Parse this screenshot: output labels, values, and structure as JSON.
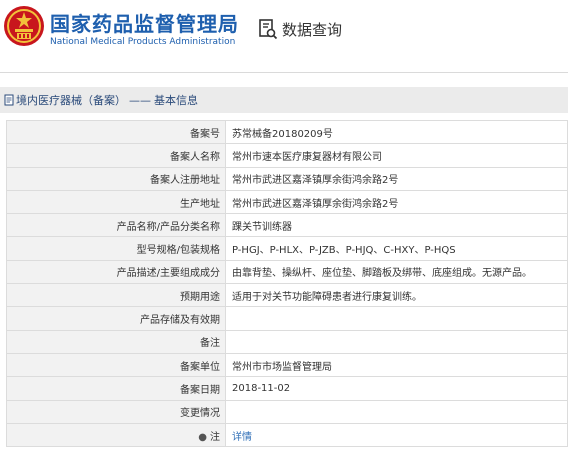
{
  "header": {
    "brand_cn": "国家药品监督管理局",
    "brand_en": "National Medical Products Administration",
    "query_label": "数据查询",
    "brand_color": "#1e5fae"
  },
  "breadcrumb": {
    "category": "境内医疗器械（备案）",
    "separator": "——",
    "section": "基本信息"
  },
  "rows": [
    {
      "label": "备案号",
      "value": "苏常械备20180209号"
    },
    {
      "label": "备案人名称",
      "value": "常州市速本医疗康复器材有限公司"
    },
    {
      "label": "备案人注册地址",
      "value": "常州市武进区嘉泽镇厚余街鸿余路2号"
    },
    {
      "label": "生产地址",
      "value": "常州市武进区嘉泽镇厚余街鸿余路2号"
    },
    {
      "label": "产品名称/产品分类名称",
      "value": "踝关节训练器"
    },
    {
      "label": "型号规格/包装规格",
      "value": "P-HGJ、P-HLX、P-JZB、P-HJQ、C-HXY、P-HQS"
    },
    {
      "label": "产品描述/主要组成成分",
      "value": "由靠背垫、操纵杆、座位垫、脚踏板及绑带、底座组成。无源产品。"
    },
    {
      "label": "预期用途",
      "value": "适用于对关节功能障碍患者进行康复训练。"
    },
    {
      "label": "产品存储及有效期",
      "value": ""
    },
    {
      "label": "备注",
      "value": ""
    },
    {
      "label": "备案单位",
      "value": "常州市市场监督管理局"
    },
    {
      "label": "备案日期",
      "value": "2018-11-02"
    },
    {
      "label": "变更情况",
      "value": ""
    }
  ],
  "note_row": {
    "label": "注",
    "link": "详情"
  }
}
